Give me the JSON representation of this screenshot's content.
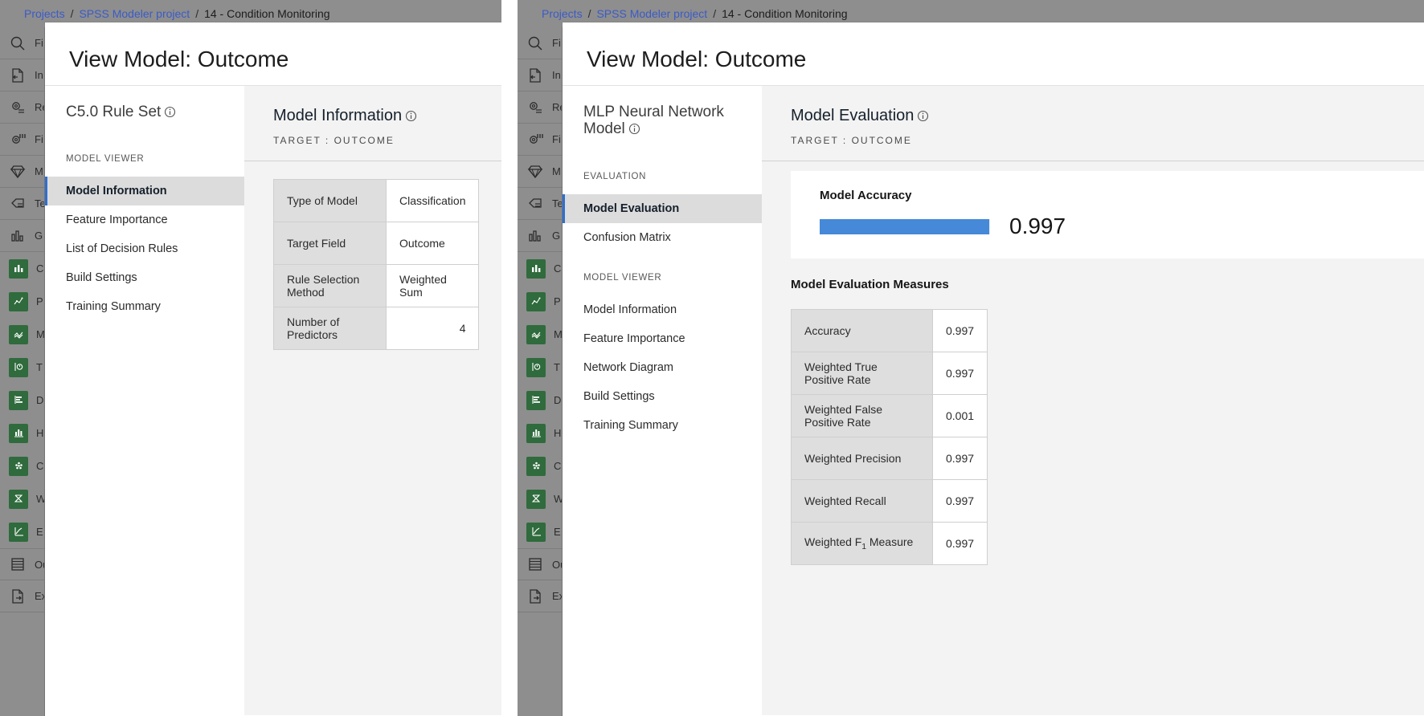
{
  "windows": [
    {
      "breadcrumb": {
        "projects": "Projects",
        "project": "SPSS Modeler project",
        "current": "14 - Condition Monitoring",
        "separator": "/"
      },
      "rail": {
        "search_placeholder": "Fi",
        "items": [
          {
            "icon": "import-node-icon",
            "label": "In"
          },
          {
            "icon": "record-operations-icon",
            "label": "Re"
          },
          {
            "icon": "field-operations-icon",
            "label": "Fi"
          },
          {
            "icon": "modeling-icon",
            "label": "M"
          },
          {
            "icon": "text-analytics-icon",
            "label": "Te"
          },
          {
            "icon": "graphs-icon",
            "label": "G"
          },
          {
            "icon": "chart-chip-icon",
            "label": "C"
          },
          {
            "icon": "plot-chip-icon",
            "label": "P"
          },
          {
            "icon": "multiplot-chip-icon",
            "label": "M"
          },
          {
            "icon": "time-plot-chip-icon",
            "label": "T"
          },
          {
            "icon": "distribution-chip-icon",
            "label": "D"
          },
          {
            "icon": "histogram-chip-icon",
            "label": "H"
          },
          {
            "icon": "collection-chip-icon",
            "label": "C"
          },
          {
            "icon": "web-chip-icon",
            "label": "W"
          },
          {
            "icon": "evaluation-chip-icon",
            "label": "E"
          },
          {
            "icon": "outputs-icon",
            "label": "Ou"
          },
          {
            "icon": "export-icon",
            "label": "Ex"
          }
        ]
      },
      "modal": {
        "title": "View Model: Outcome",
        "model_name": "C5.0 Rule Set",
        "nav_groups": [
          {
            "label": "MODEL VIEWER",
            "items": [
              {
                "label": "Model Information",
                "active": true
              },
              {
                "label": "Feature Importance",
                "active": false
              },
              {
                "label": "List of Decision Rules",
                "active": false
              },
              {
                "label": "Build Settings",
                "active": false
              },
              {
                "label": "Training Summary",
                "active": false
              }
            ]
          }
        ],
        "section": {
          "title": "Model Information",
          "target_line": "TARGET : OUTCOME",
          "table": {
            "rows": [
              {
                "key": "Type of Model",
                "value": "Classification",
                "numeric": false
              },
              {
                "key": "Target Field",
                "value": "Outcome",
                "numeric": false
              },
              {
                "key": "Rule Selection Method",
                "value": "Weighted Sum",
                "numeric": false
              },
              {
                "key": "Number of Predictors",
                "value": "4",
                "numeric": true
              }
            ]
          }
        }
      }
    },
    {
      "breadcrumb": {
        "projects": "Projects",
        "project": "SPSS Modeler project",
        "current": "14 - Condition Monitoring",
        "separator": "/"
      },
      "rail": {
        "search_placeholder": "Fi",
        "items": [
          {
            "icon": "import-node-icon",
            "label": "In"
          },
          {
            "icon": "record-operations-icon",
            "label": "Re"
          },
          {
            "icon": "field-operations-icon",
            "label": "Fi"
          },
          {
            "icon": "modeling-icon",
            "label": "M"
          },
          {
            "icon": "text-analytics-icon",
            "label": "Te"
          },
          {
            "icon": "graphs-icon",
            "label": "G"
          },
          {
            "icon": "chart-chip-icon",
            "label": "C"
          },
          {
            "icon": "plot-chip-icon",
            "label": "P"
          },
          {
            "icon": "multiplot-chip-icon",
            "label": "M"
          },
          {
            "icon": "time-plot-chip-icon",
            "label": "T"
          },
          {
            "icon": "distribution-chip-icon",
            "label": "D"
          },
          {
            "icon": "histogram-chip-icon",
            "label": "H"
          },
          {
            "icon": "collection-chip-icon",
            "label": "C"
          },
          {
            "icon": "web-chip-icon",
            "label": "W"
          },
          {
            "icon": "evaluation-chip-icon",
            "label": "E"
          },
          {
            "icon": "outputs-icon",
            "label": "Ou"
          },
          {
            "icon": "export-icon",
            "label": "Ex"
          }
        ]
      },
      "modal": {
        "title": "View Model: Outcome",
        "model_name": "MLP Neural Network Model",
        "nav_groups": [
          {
            "label": "EVALUATION",
            "items": [
              {
                "label": "Model Evaluation",
                "active": true
              },
              {
                "label": "Confusion Matrix",
                "active": false
              }
            ]
          },
          {
            "label": "MODEL VIEWER",
            "items": [
              {
                "label": "Model Information",
                "active": false
              },
              {
                "label": "Feature Importance",
                "active": false
              },
              {
                "label": "Network Diagram",
                "active": false
              },
              {
                "label": "Build Settings",
                "active": false
              },
              {
                "label": "Training Summary",
                "active": false
              }
            ]
          }
        ],
        "section": {
          "title": "Model Evaluation",
          "target_line": "TARGET : OUTCOME",
          "accuracy_card": {
            "label": "Model Accuracy",
            "value": "0.997",
            "fill_percent": 99.7,
            "bar_color": "#4589d8"
          },
          "measures_title": "Model Evaluation Measures",
          "measures_table": {
            "rows": [
              {
                "key": "Accuracy",
                "value": "0.997"
              },
              {
                "key": "Weighted True Positive Rate",
                "value": "0.997"
              },
              {
                "key": "Weighted False Positive Rate",
                "value": "0.001"
              },
              {
                "key": "Weighted Precision",
                "value": "0.997"
              },
              {
                "key": "Weighted Recall",
                "value": "0.997"
              },
              {
                "key": "Weighted F1 Measure",
                "value": "0.997",
                "subscript": true,
                "prefix": "Weighted F",
                "sub": "1",
                "suffix": " Measure"
              }
            ]
          }
        }
      }
    }
  ],
  "colors": {
    "rail_bg": "#8e8e8e",
    "accent_blue": "#2f6fd0",
    "bar_blue": "#4589d8",
    "chip_green": "#2f6b3c",
    "active_row": "#dcdcdc",
    "content_bg": "#f3f3f3"
  }
}
